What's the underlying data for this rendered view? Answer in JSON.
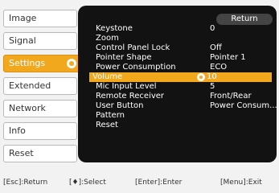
{
  "sidebar": {
    "items": [
      {
        "label": "Image"
      },
      {
        "label": "Signal"
      },
      {
        "label": "Settings"
      },
      {
        "label": "Extended"
      },
      {
        "label": "Network"
      },
      {
        "label": "Info"
      },
      {
        "label": "Reset"
      }
    ]
  },
  "panel": {
    "return_label": "Return",
    "rows": [
      {
        "label": "Keystone",
        "value": "0"
      },
      {
        "label": "Zoom",
        "value": ""
      },
      {
        "label": "Control Panel Lock",
        "value": "Off"
      },
      {
        "label": "Pointer Shape",
        "value": "Pointer 1"
      },
      {
        "label": "Power Consumption",
        "value": "ECO"
      },
      {
        "label": "Volume",
        "value": "10"
      },
      {
        "label": "Mic Input Level",
        "value": "5"
      },
      {
        "label": "Remote Receiver",
        "value": "Front/Rear"
      },
      {
        "label": "User Button",
        "value": "Power Consum..."
      },
      {
        "label": "Pattern",
        "value": ""
      },
      {
        "label": "Reset",
        "value": ""
      }
    ]
  },
  "footer": {
    "esc": "[Esc]:Return",
    "select": "[♦]:Select",
    "enter": "[Enter]:Enter",
    "menu": "[Menu]:Exit"
  },
  "colors": {
    "accent": "#f2a81c",
    "panel_bg": "#121212",
    "page_bg": "#f2f2f2"
  },
  "icons": {
    "active_indicator": "select-indicator-icon"
  }
}
